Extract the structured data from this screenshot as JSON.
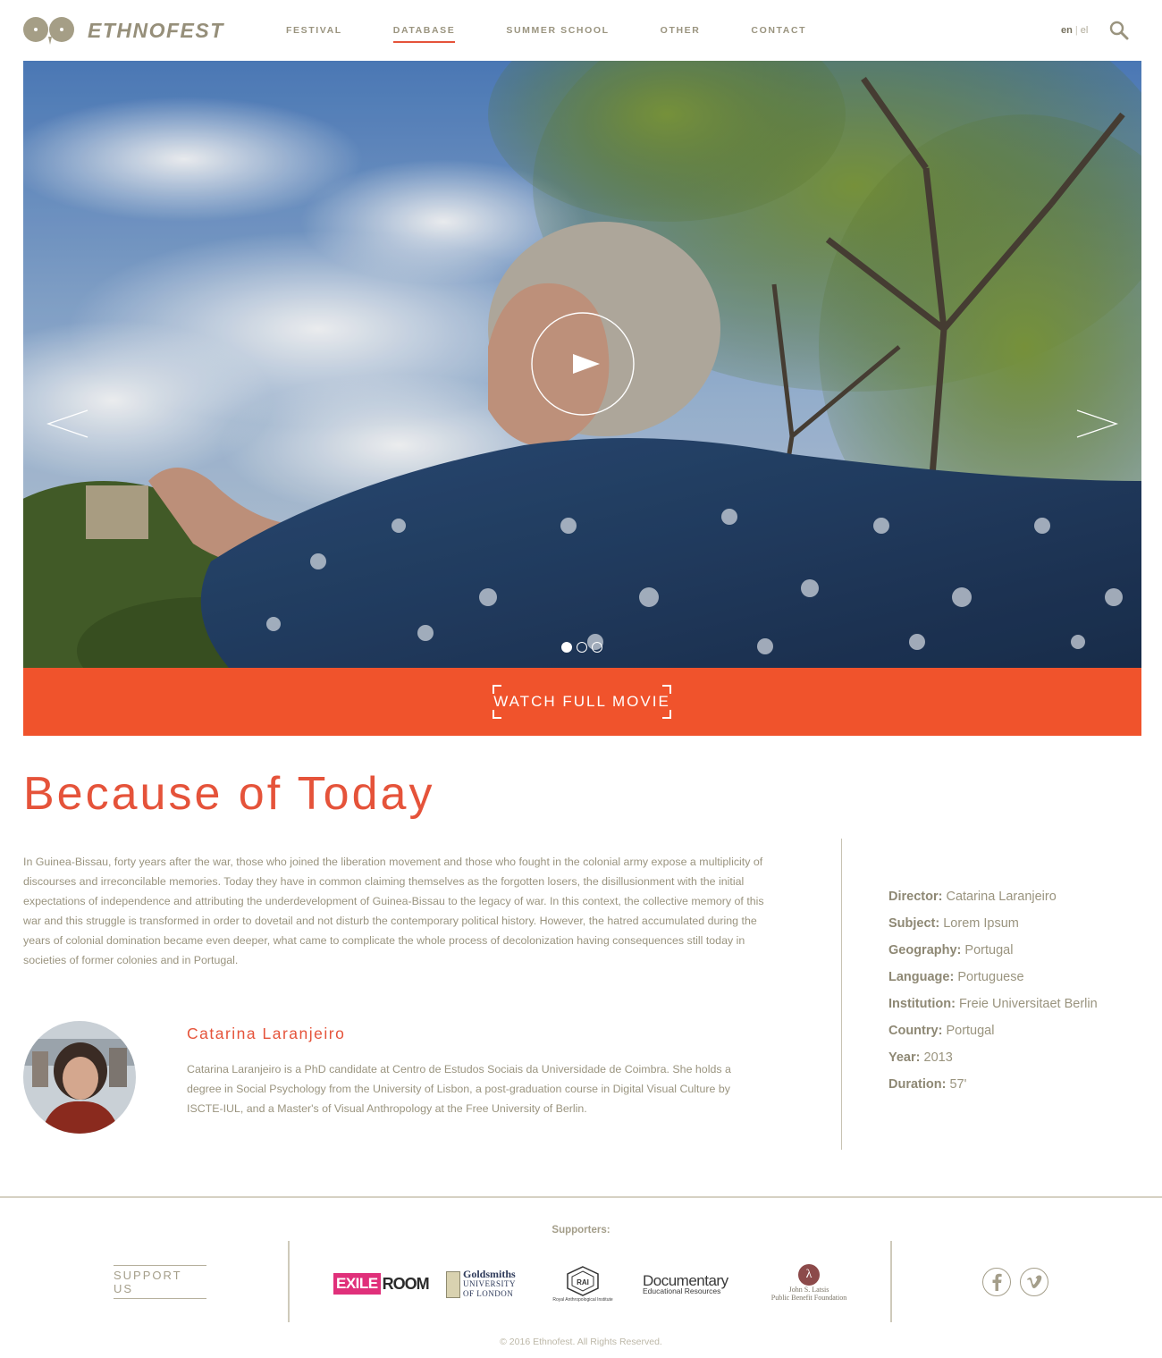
{
  "brand": {
    "name": "ETHNOFEST"
  },
  "nav": {
    "items": [
      {
        "label": "FESTIVAL",
        "active": false
      },
      {
        "label": "DATABASE",
        "active": true
      },
      {
        "label": "SUMMER SCHOOL",
        "active": false
      },
      {
        "label": "OTHER",
        "active": false
      },
      {
        "label": "CONTACT",
        "active": false
      }
    ]
  },
  "lang": {
    "current": "en",
    "separator": "|",
    "other": "el"
  },
  "icons": {
    "search": "search-icon",
    "prev": "chevron-left-icon",
    "next": "chevron-right-icon",
    "play": "play-icon",
    "facebook": "facebook-icon",
    "vimeo": "vimeo-icon"
  },
  "hero": {
    "slides_total": 3,
    "active_slide": 1
  },
  "watch": {
    "label": "WATCH FULL MOVIE"
  },
  "film": {
    "title": "Because of Today",
    "synopsis": "In Guinea-Bissau, forty years after the war, those who joined the liberation movement and those who fought in the colonial army expose a multiplicity of discourses and irreconcilable memories. Today they have in common claiming themselves as the forgotten losers, the disillusionment with the initial expectations of independence and attributing the underdevelopment of Guinea-Bissau to the legacy of war. In this context, the collective memory of this war and this struggle is transformed in order to dovetail and not disturb the contemporary political history. However, the hatred accumulated during the years of colonial domination became even deeper, what came to complicate the whole process of decolonization having consequences still today in societies of former colonies and in Portugal."
  },
  "director": {
    "name": "Catarina Laranjeiro",
    "bio": "Catarina Laranjeiro is a PhD candidate at Centro de Estudos Sociais da Universidade de Coimbra. She holds a degree in Social Psychology from the University of Lisbon, a post-graduation course in Digital Visual Culture by ISCTE-IUL, and a Master's of Visual Anthropology at the Free University of Berlin."
  },
  "meta": [
    {
      "key": "Director:",
      "value": "Catarina Laranjeiro"
    },
    {
      "key": "Subject:",
      "value": "Lorem Ipsum"
    },
    {
      "key": "Geography:",
      "value": "Portugal"
    },
    {
      "key": "Language:",
      "value": "Portuguese"
    },
    {
      "key": "Institution:",
      "value": "Freie Universitaet Berlin"
    },
    {
      "key": "Country:",
      "value": "Portugal"
    },
    {
      "key": "Year:",
      "value": "2013"
    },
    {
      "key": "Duration:",
      "value": "57'"
    }
  ],
  "footer": {
    "supporters_label": "Supporters:",
    "support_button": "SUPPORT US",
    "sponsors": {
      "exile": {
        "part1": "EXILE",
        "part2": "ROOM"
      },
      "goldsmiths": {
        "line1": "Goldsmiths",
        "line2": "UNIVERSITY",
        "line3": "OF LONDON"
      },
      "rai": {
        "mark": "RAI",
        "caption": "Royal Anthropological Institute"
      },
      "documentary": {
        "line1": "Documentary",
        "line2": "Educational Resources"
      },
      "latsis": {
        "line1": "John S. Latsis",
        "line2": "Public Benefit Foundation"
      }
    },
    "copyright": "© 2016 Ethnofest. All Rights Reserved."
  },
  "colors": {
    "accent": "#e5533a",
    "band": "#f0532c",
    "text_muted": "#9a947f",
    "divider": "#c7c2b2"
  }
}
